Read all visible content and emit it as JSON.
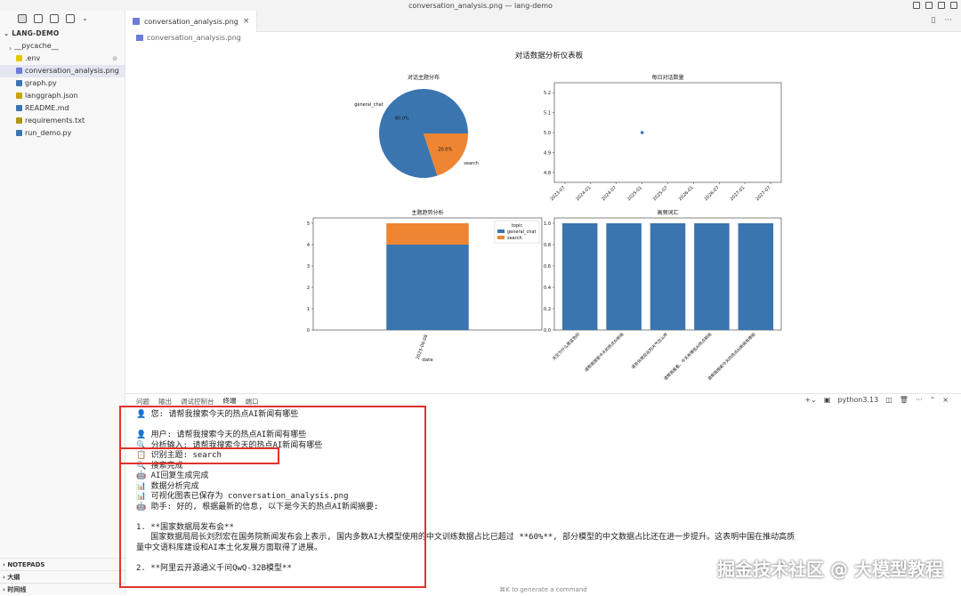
{
  "window_title": "conversation_analysis.png — lang-demo",
  "sidebar": {
    "project": "LANG-DEMO",
    "files": [
      {
        "label": "__pycache__",
        "type": "folder",
        "color": "#999"
      },
      {
        "label": ".env",
        "type": "file",
        "color": "#e3c800",
        "badge": "⊘"
      },
      {
        "label": "conversation_analysis.png",
        "type": "image",
        "color": "#6c7bd6"
      },
      {
        "label": "graph.py",
        "type": "python",
        "color": "#3a76b0"
      },
      {
        "label": "langgraph.json",
        "type": "json",
        "color": "#c9a400"
      },
      {
        "label": "README.md",
        "type": "md",
        "color": "#3a76b0"
      },
      {
        "label": "requirements.txt",
        "type": "txt",
        "color": "#b4941a"
      },
      {
        "label": "run_demo.py",
        "type": "python",
        "color": "#3a76b0"
      }
    ],
    "bottom": [
      "NOTEPADS",
      "大纲",
      "时间线"
    ]
  },
  "tab": {
    "label": "conversation_analysis.png",
    "close": "×"
  },
  "breadcrumb": "conversation_analysis.png",
  "figure": {
    "title": "对话数据分析仪表板"
  },
  "chart_data": [
    {
      "type": "pie",
      "title": "对话主题分布",
      "slices": [
        {
          "label": "general_chat",
          "value": 80.0,
          "text": "80.0%",
          "color": "#3a75b0"
        },
        {
          "label": "search",
          "value": 20.0,
          "text": "20.0%",
          "color": "#ee8532"
        }
      ]
    },
    {
      "type": "scatter",
      "title": "每日对话数量",
      "x": [
        "2025-01"
      ],
      "y": [
        5.0
      ],
      "yticks": [
        "4.8",
        "4.9",
        "5.0",
        "5.1",
        "5.2"
      ],
      "xticks": [
        "2023-07",
        "2024-01",
        "2024-07",
        "2025-01",
        "2025-07",
        "2026-01",
        "2026-07",
        "2027-01",
        "2027-07"
      ],
      "ylim": [
        4.75,
        5.25
      ]
    },
    {
      "type": "bar",
      "title": "主题趋势分析",
      "categories": [
        "2025-06-08"
      ],
      "series": [
        {
          "name": "general_chat",
          "values": [
            4
          ],
          "color": "#3a75b0"
        },
        {
          "name": "search",
          "values": [
            1
          ],
          "color": "#ee8532"
        }
      ],
      "xlabel": "date",
      "legend_title": "topic",
      "yticks": [
        "0",
        "1",
        "2",
        "3",
        "4",
        "5"
      ],
      "ylim": [
        0,
        5.25
      ]
    },
    {
      "type": "bar",
      "title": "高频词汇",
      "categories": [
        "天空为什么是蓝色的",
        "请帮我搜索今天的热点AI新闻",
        "请告诉我现在的天气怎么样",
        "请帮我看看，今天有哪些AI热点新闻",
        "请帮我搜索今天的热点AI新闻有哪些"
      ],
      "values": [
        1.0,
        1.0,
        1.0,
        1.0,
        1.0
      ],
      "yticks": [
        "0.0",
        "0.2",
        "0.4",
        "0.6",
        "0.8",
        "1.0"
      ],
      "ylim": [
        0,
        1.05
      ],
      "color": "#3a75b0"
    }
  ],
  "panel": {
    "tabs": [
      "问题",
      "输出",
      "调试控制台",
      "终端",
      "端口"
    ],
    "active": "终端",
    "shell": "python3.13",
    "lines": [
      "👤 您: 请帮我搜索今天的热点AI新闻有哪些",
      "",
      "👤 用户: 请帮我搜索今天的热点AI新闻有哪些",
      "🔍 分析输入: 请帮我搜索今天的热点AI新闻有哪些",
      "📋 识别主题: search",
      "🔍 搜索完成",
      "🤖 AI回复生成完成",
      "📊 数据分析完成",
      "📊 可视化图表已保存为 conversation_analysis.png",
      "🤖 助手: 好的, 根据最新的信息, 以下是今天的热点AI新闻摘要:",
      "",
      "1. **国家数据局发布会**",
      "   国家数据局局长刘烈宏在国务院新闻发布会上表示, 国内多数AI大模型使用的中文训练数据占比已超过 **60%**, 部分模型的中文数据占比还在进一步提升。这表明中国在推动高质",
      "量中文语料库建设和AI本土化发展方面取得了进展。",
      "",
      "2. **阿里云开源通义千问QwQ-32B模型**"
    ],
    "generate": "⌘K to generate a command"
  },
  "watermark": "掘金技术社区 @ 大模型教程"
}
